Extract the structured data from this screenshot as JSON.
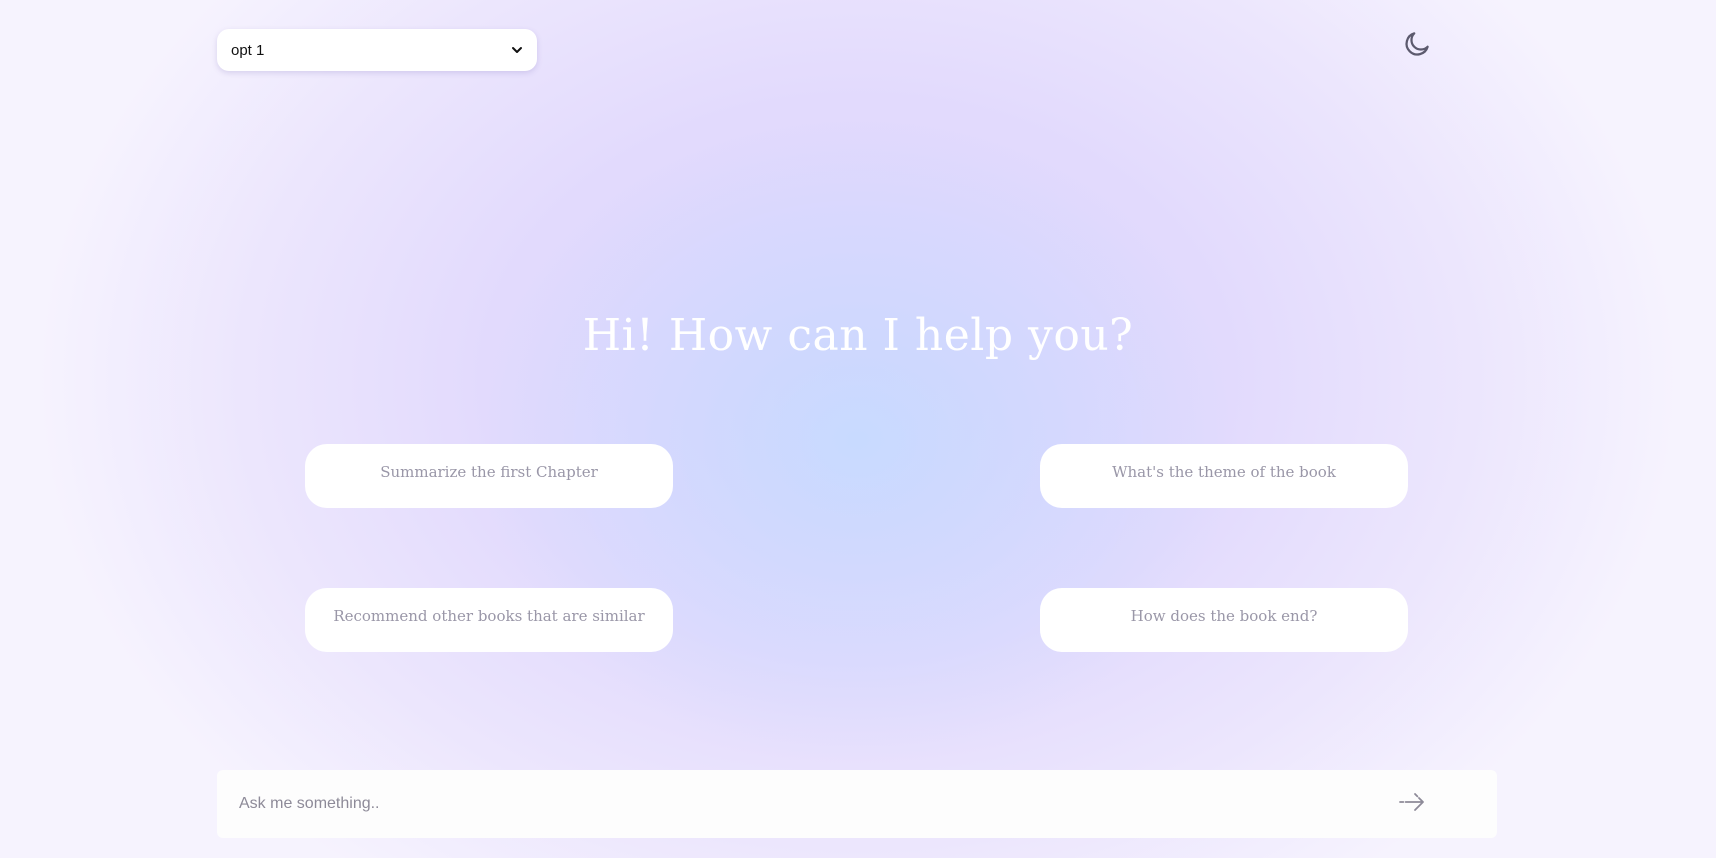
{
  "model_select": {
    "selected": "opt 1"
  },
  "theme_toggle": {
    "icon": "moon-icon"
  },
  "hero": {
    "title": "Hi! How can I help you?"
  },
  "suggestions": [
    {
      "label": "Summarize the first Chapter"
    },
    {
      "label": "What's the theme of the book"
    },
    {
      "label": "Recommend other books that are similar"
    },
    {
      "label": "How does the book end?"
    }
  ],
  "chat": {
    "placeholder": "Ask me something..",
    "send_icon": "arrow-right-icon"
  },
  "colors": {
    "background_lavender": "#dcd3fd",
    "background_blue": "#c8daff",
    "suggestion_text": "#9a97a8",
    "icon": "#5c5a6e"
  }
}
